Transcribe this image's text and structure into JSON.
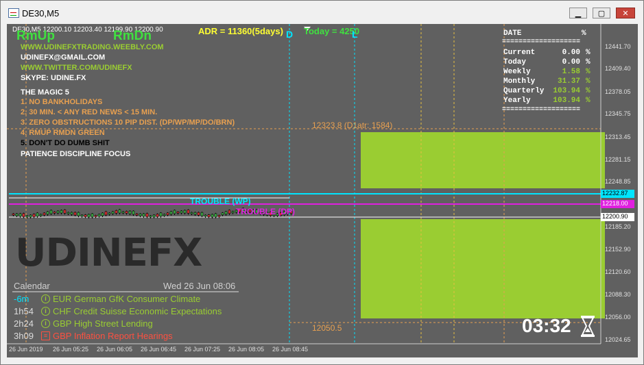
{
  "window": {
    "title": "DE30,M5",
    "min_glyph": "▁",
    "max_glyph": "▢",
    "close_glyph": "✕"
  },
  "chart": {
    "header": "DE30,M5  12200.10 12203.40 12199.90 12200.90",
    "rm_up": "RmUp",
    "rm_dn": "RmDn",
    "adr": "ADR = 11360(5days)",
    "today": "Today = 4250",
    "marker_d": "D",
    "marker_l": "L",
    "info_lines": [
      {
        "text": "WWW.UDINEFXTRADING.WEEBLY.COM",
        "color": "#9acd32"
      },
      {
        "text": "UDINEFX@GMAIL.COM",
        "color": "#ffffff"
      },
      {
        "text": "WWW.TWITTER.COM/UDINEFX",
        "color": "#9acd32"
      },
      {
        "text": "SKYPE: UDINE.FX",
        "color": "#ffffff"
      }
    ],
    "magic_title": "THE MAGIC 5",
    "magic_rules": [
      {
        "text": "1. NO BANKHOLIDAYS",
        "color": "#e8a050"
      },
      {
        "text": "2. 30 MIN. < ANY RED NEWS < 15 MIN.",
        "color": "#e8a050"
      },
      {
        "text": "3. ZERO OBSTRUCTIONS 10 PIP DIST. (DP/WP/MP/DO/BRN)",
        "color": "#e8a050"
      },
      {
        "text": "4. RMUP RMDN GREEN",
        "color": "#e8a050"
      },
      {
        "text": "5. DON'T DO DUMB SHIT",
        "color": "#000000"
      }
    ],
    "motto": "PATIENCE DISCIPLINE FOCUS",
    "level_high": "12323.8   (D1atr: 1584)",
    "level_low": "12050.5",
    "trouble_wp": "TROUBLE (WP)",
    "trouble_dp": "TROUBLE (DP)",
    "brand": "UDINEFX",
    "stats": {
      "header_date": "DATE",
      "header_pct": "%",
      "separator": "===================",
      "rows": [
        {
          "label": "Current",
          "value": "0.00",
          "unit": "%",
          "color": "#ffffff"
        },
        {
          "label": "Today",
          "value": "0.00",
          "unit": "%",
          "color": "#ffffff"
        },
        {
          "label": "Weekly",
          "value": "1.58",
          "unit": "%",
          "color": "#9acd32"
        },
        {
          "label": "Monthly",
          "value": "31.37",
          "unit": "%",
          "color": "#9acd32"
        },
        {
          "label": "Quarterly",
          "value": "103.94",
          "unit": "%",
          "color": "#9acd32"
        },
        {
          "label": "Yearly",
          "value": "103.94",
          "unit": "%",
          "color": "#9acd32"
        }
      ]
    },
    "calendar": {
      "title": "Calendar",
      "datetime": "Wed 26 Jun 08:06",
      "events": [
        {
          "time": "-6m",
          "time_color": "#00e5ff",
          "icon": "info-icon",
          "text": "EUR German GfK Consumer Climate",
          "color": "#9acd32"
        },
        {
          "time": "1h54",
          "time_color": "#dcdcdc",
          "icon": "info-icon",
          "text": "CHF Credit Suisse Economic Expectations",
          "color": "#9acd32"
        },
        {
          "time": "2h24",
          "time_color": "#dcdcdc",
          "icon": "info-icon",
          "text": "GBP High Street Lending",
          "color": "#9acd32"
        },
        {
          "time": "3h09",
          "time_color": "#dcdcdc",
          "icon": "document-icon",
          "text": "GBP Inflation Report Hearings",
          "color": "#ff5040"
        }
      ]
    },
    "countdown": "03:32",
    "price_axis": [
      "12441.70",
      "12409.40",
      "12378.05",
      "12345.75",
      "12313.45",
      "12281.15",
      "12248.85",
      "12185.20",
      "12152.90",
      "12120.60",
      "12088.30",
      "12056.00",
      "12024.65"
    ],
    "price_tags": {
      "cyan": "12232.87",
      "magenta": "12218.00",
      "current": "12200.90"
    },
    "time_axis": [
      "26 Jun 2019",
      "26 Jun 05:25",
      "26 Jun 06:05",
      "26 Jun 06:45",
      "26 Jun 07:25",
      "26 Jun 08:05",
      "26 Jun 08:45"
    ],
    "colors": {
      "background": "#606060",
      "green_zone": "#9acd32",
      "cyan": "#00e5ff",
      "magenta": "#e020e0",
      "orange": "#e8a050"
    }
  }
}
